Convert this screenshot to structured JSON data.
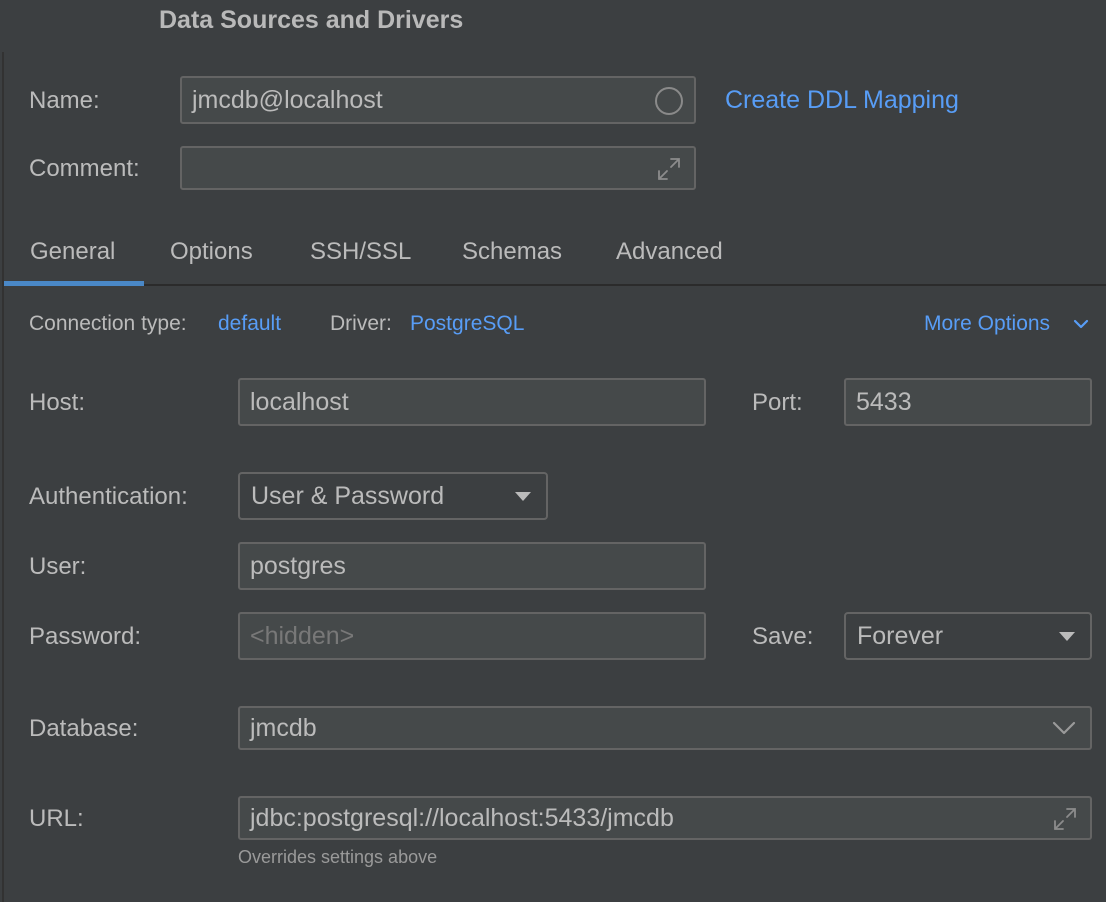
{
  "window": {
    "title": "Data Sources and Drivers"
  },
  "name_row": {
    "label": "Name:",
    "value": "jmcdb@localhost",
    "link": "Create DDL Mapping"
  },
  "comment_row": {
    "label": "Comment:",
    "value": ""
  },
  "tabs": [
    {
      "label": "General",
      "active": true
    },
    {
      "label": "Options",
      "active": false
    },
    {
      "label": "SSH/SSL",
      "active": false
    },
    {
      "label": "Schemas",
      "active": false
    },
    {
      "label": "Advanced",
      "active": false
    }
  ],
  "connection": {
    "type_label": "Connection type:",
    "type_value": "default",
    "driver_label": "Driver:",
    "driver_value": "PostgreSQL",
    "more_options": "More Options"
  },
  "host": {
    "label": "Host:",
    "value": "localhost"
  },
  "port": {
    "label": "Port:",
    "value": "5433"
  },
  "authentication": {
    "label": "Authentication:",
    "value": "User & Password"
  },
  "user": {
    "label": "User:",
    "value": "postgres"
  },
  "password": {
    "label": "Password:",
    "placeholder": "<hidden>"
  },
  "save": {
    "label": "Save:",
    "value": "Forever"
  },
  "database": {
    "label": "Database:",
    "value": "jmcdb"
  },
  "url": {
    "label": "URL:",
    "value": "jdbc:postgresql://localhost:5433/jmcdb",
    "hint": "Overrides settings above"
  },
  "colors": {
    "background": "#3c3f41",
    "field": "#45494a",
    "border": "#646464",
    "text": "#bbbbbb",
    "link": "#589df6",
    "tab_accent": "#4a88c7"
  },
  "icons": {
    "name_status": "circle-icon",
    "expand": "expand-icon",
    "dropdown": "chevron-down-icon"
  }
}
